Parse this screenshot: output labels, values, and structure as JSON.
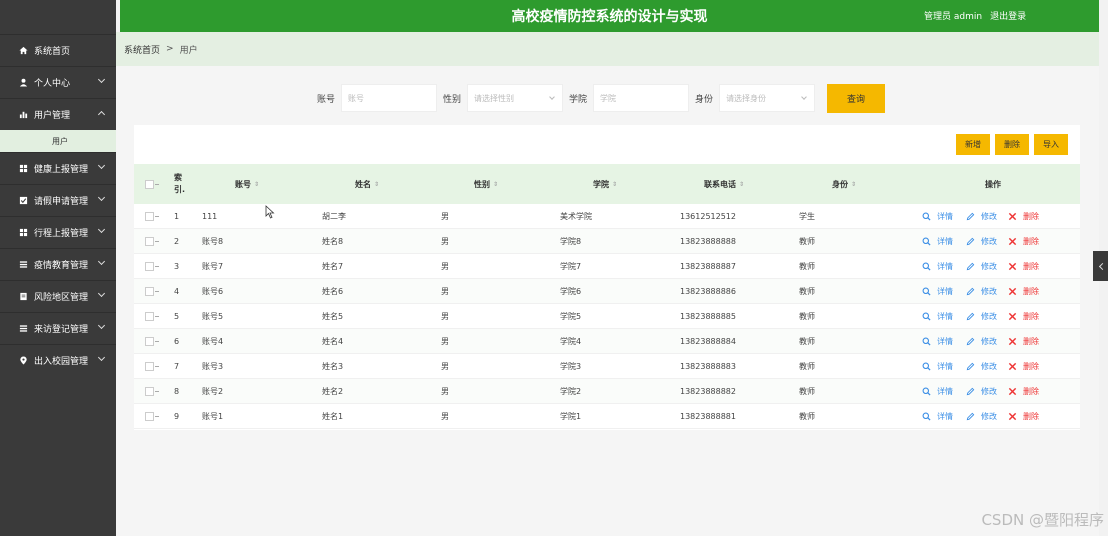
{
  "header": {
    "title": "高校疫情防控系统的设计与实现",
    "user": "管理员 admin",
    "logout": "退出登录"
  },
  "breadcrumb": {
    "home": "系统首页",
    "separator": ">",
    "current": "用户"
  },
  "sidebar": {
    "items": [
      {
        "label": "系统首页",
        "icon": "home-icon",
        "has_arrow": false
      },
      {
        "label": "个人中心",
        "icon": "user-icon",
        "has_arrow": true
      },
      {
        "label": "用户管理",
        "icon": "bar-chart-icon",
        "has_arrow": true,
        "open": true
      },
      {
        "label": "健康上报管理",
        "icon": "grid-icon",
        "has_arrow": true
      },
      {
        "label": "请假申请管理",
        "icon": "checkbox-icon",
        "has_arrow": true
      },
      {
        "label": "行程上报管理",
        "icon": "grid-icon",
        "has_arrow": true
      },
      {
        "label": "疫情教育管理",
        "icon": "list-icon",
        "has_arrow": true
      },
      {
        "label": "风险地区管理",
        "icon": "document-icon",
        "has_arrow": true
      },
      {
        "label": "来访登记管理",
        "icon": "list-icon",
        "has_arrow": true
      },
      {
        "label": "出入校园管理",
        "icon": "pin-icon",
        "has_arrow": true
      }
    ],
    "subitem": "用户"
  },
  "search": {
    "account_label": "账号",
    "account_placeholder": "账号",
    "gender_label": "性别",
    "gender_placeholder": "请选择性别",
    "college_label": "学院",
    "college_placeholder": "学院",
    "role_label": "身份",
    "role_placeholder": "请选择身份",
    "query_button": "查询"
  },
  "toolbar": {
    "add": "新增",
    "delete": "删除",
    "import": "导入"
  },
  "table": {
    "columns": {
      "index": "索\n引.",
      "account": "账号",
      "name": "姓名",
      "gender": "性别",
      "college": "学院",
      "phone": "联系电话",
      "role": "身份",
      "ops": "操作"
    },
    "actions": {
      "detail": "详情",
      "edit": "修改",
      "delete": "删除"
    },
    "rows": [
      {
        "index": "1",
        "account": "111",
        "name": "胡二李",
        "gender": "男",
        "college": "美术学院",
        "phone": "13612512512",
        "role": "学生"
      },
      {
        "index": "2",
        "account": "账号8",
        "name": "姓名8",
        "gender": "男",
        "college": "学院8",
        "phone": "13823888888",
        "role": "教师"
      },
      {
        "index": "3",
        "account": "账号7",
        "name": "姓名7",
        "gender": "男",
        "college": "学院7",
        "phone": "13823888887",
        "role": "教师"
      },
      {
        "index": "4",
        "account": "账号6",
        "name": "姓名6",
        "gender": "男",
        "college": "学院6",
        "phone": "13823888886",
        "role": "教师"
      },
      {
        "index": "5",
        "account": "账号5",
        "name": "姓名5",
        "gender": "男",
        "college": "学院5",
        "phone": "13823888885",
        "role": "教师"
      },
      {
        "index": "6",
        "account": "账号4",
        "name": "姓名4",
        "gender": "男",
        "college": "学院4",
        "phone": "13823888884",
        "role": "教师"
      },
      {
        "index": "7",
        "account": "账号3",
        "name": "姓名3",
        "gender": "男",
        "college": "学院3",
        "phone": "13823888883",
        "role": "教师"
      },
      {
        "index": "8",
        "account": "账号2",
        "name": "姓名2",
        "gender": "男",
        "college": "学院2",
        "phone": "13823888882",
        "role": "教师"
      },
      {
        "index": "9",
        "account": "账号1",
        "name": "姓名1",
        "gender": "男",
        "college": "学院1",
        "phone": "13823888881",
        "role": "教师"
      }
    ]
  },
  "watermark": "CSDN @暨阳程序",
  "colors": {
    "header": "#2e9b2e",
    "sidebar": "#3a3a3a",
    "accent": "#f5b800",
    "link": "#3a8ee6",
    "danger": "#e33333"
  }
}
